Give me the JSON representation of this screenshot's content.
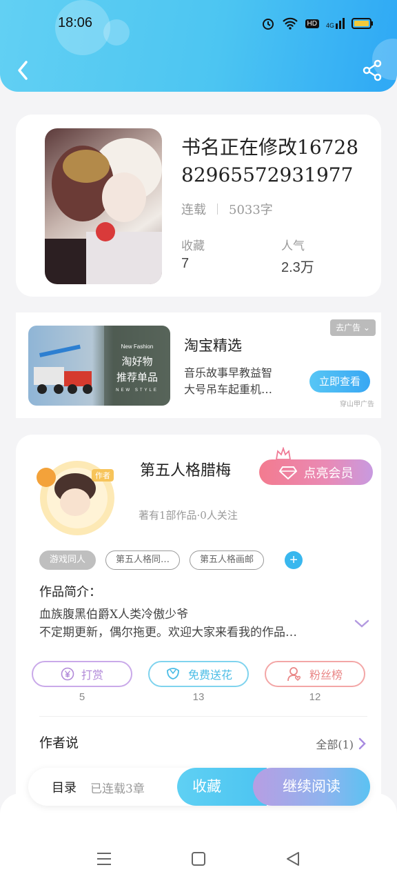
{
  "status_bar": {
    "time": "18:06",
    "icons": [
      "alarm-icon",
      "wifi-icon",
      "hd-icon",
      "4g-signal-icon",
      "battery-icon"
    ],
    "hd_label": "HD",
    "net_label": "4G"
  },
  "header": {
    "back_icon": "chevron-left-icon",
    "share_icon": "share-icon"
  },
  "book": {
    "title": "书名正在修改1672882965572931977",
    "status": "连载",
    "word_count": "5033字",
    "favorites_label": "收藏",
    "favorites_value": "7",
    "popularity_label": "人气",
    "popularity_value": "2.3万"
  },
  "ad": {
    "image_line1": "New Fashion",
    "image_line2": "淘好物",
    "image_line3": "推荐单品",
    "image_line4": "NEW STYLE",
    "close_label": "去广告 ⌄",
    "title": "淘宝精选",
    "desc_line1": "音乐故事早教益智",
    "desc_line2": "大号吊车起重机…",
    "cta": "立即查看",
    "source": "穿山甲广告"
  },
  "author": {
    "name": "第五人格腊梅",
    "avatar_badge": "作者",
    "vip_button": "点亮会员",
    "stats": "著有1部作品·0人关注",
    "tags": [
      "游戏同人",
      "第五人格同…",
      "第五人格画邮"
    ],
    "tag_add": "+",
    "intro_label": "作品简介：",
    "intro_line1": "血族腹黑伯爵X人类冷傲少爷",
    "intro_line2": "不定期更新，偶尔拖更。欢迎大家来看我的作品…",
    "actions": [
      {
        "label": "打赏",
        "count": "5",
        "icon": "yen-coin-icon"
      },
      {
        "label": "免费送花",
        "count": "13",
        "icon": "flower-icon"
      },
      {
        "label": "粉丝榜",
        "count": "12",
        "icon": "user-heart-icon"
      }
    ],
    "author_says": "作者说",
    "all_link": "全部(1)"
  },
  "bottom_bar": {
    "toc_label": "目录",
    "toc_sub": "已连载3章",
    "favorite_button": "收藏",
    "read_button": "继续阅读"
  },
  "system_nav": [
    "menu-icon",
    "home-square-icon",
    "back-triangle-icon"
  ],
  "colors": {
    "primary": "#4cc5f2",
    "vip": "#f37b8f",
    "reward": "#b28ad9",
    "flower": "#4cbde6",
    "fans": "#e98686"
  }
}
